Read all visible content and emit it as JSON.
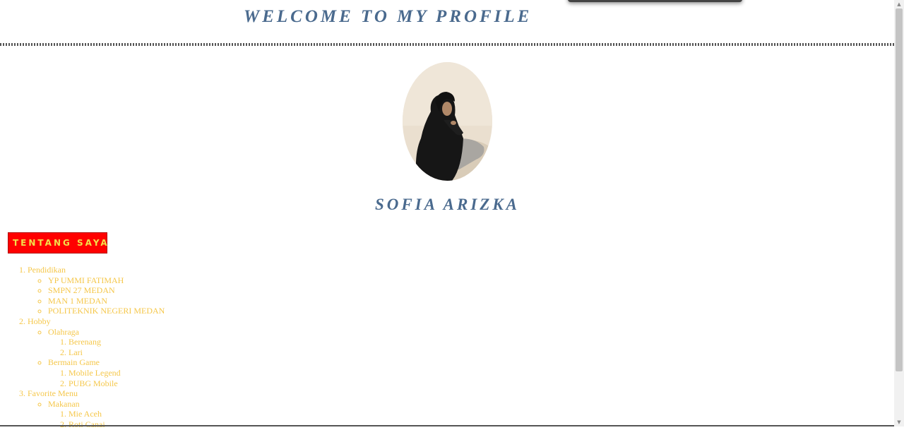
{
  "header": {
    "title": "WELCOME TO MY PROFILE"
  },
  "profile": {
    "name": "SOFIA ARIZKA",
    "photo_icon": "profile-photo"
  },
  "section": {
    "label": "TENTANG SAYA"
  },
  "outline": {
    "pendidikan": {
      "label": "Pendidikan",
      "items": [
        "YP UMMI FATIMAH",
        "SMPN 27 MEDAN",
        "MAN 1 MEDAN",
        "POLITEKNIK NEGERI MEDAN"
      ]
    },
    "hobby": {
      "label": "Hobby",
      "olahraga": {
        "label": "Olahraga",
        "items": [
          "Berenang",
          "Lari"
        ]
      },
      "game": {
        "label": "Bermain Game",
        "items": [
          "Mobile Legend",
          "PUBG Mobile"
        ]
      }
    },
    "menu": {
      "label": "Favorite Menu",
      "makanan": {
        "label": "Makanan",
        "items": [
          "Mie Aceh",
          "Roti Canai"
        ]
      }
    }
  },
  "colors": {
    "heading": "#4a6a8e",
    "badge_bg": "#ff0000",
    "badge_text": "#f2e04a",
    "list_text": "#f5c74a"
  }
}
